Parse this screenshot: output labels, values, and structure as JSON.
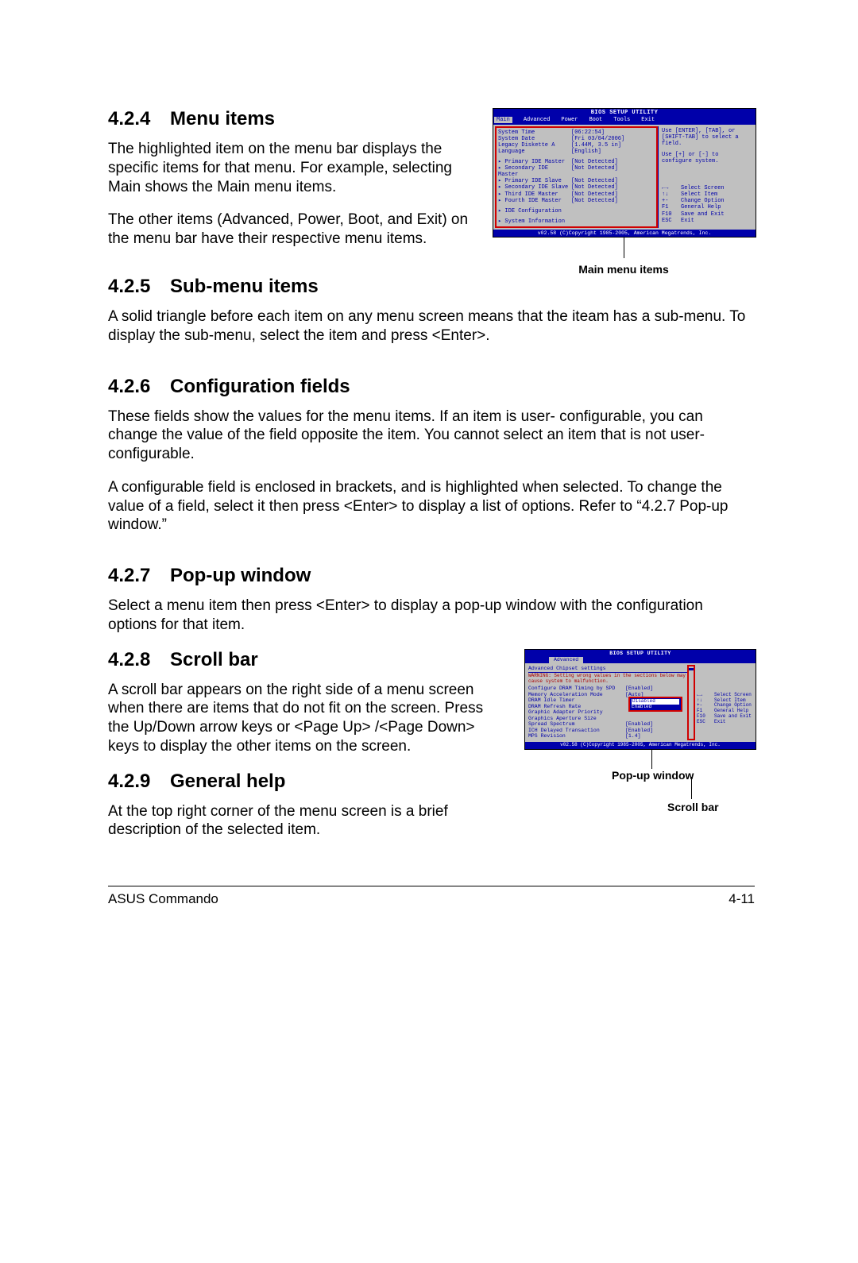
{
  "sections": {
    "s424": {
      "num": "4.2.4",
      "title": "Menu items",
      "p1": "The highlighted item on the menu bar displays the specific items for that menu. For example, selecting Main shows the Main menu items.",
      "p2": "The other items (Advanced, Power, Boot, and Exit) on the menu bar have their respective menu items."
    },
    "s425": {
      "num": "4.2.5",
      "title": "Sub-menu items",
      "p1": "A solid triangle before each item on any menu screen means that the iteam has a sub-menu. To display the sub-menu, select the item and press <Enter>."
    },
    "s426": {
      "num": "4.2.6",
      "title": "Configuration fields",
      "p1": "These fields show the values for the menu items. If an item is user- configurable, you can change the value of the field opposite the item. You cannot select an item that is not user-configurable.",
      "p2": "A configurable field is enclosed in brackets, and is highlighted when selected. To change the value of a field, select it then press <Enter> to display a list of options. Refer to “4.2.7 Pop-up window.”"
    },
    "s427": {
      "num": "4.2.7",
      "title": "Pop-up window",
      "p1": "Select a menu item then press <Enter> to display a pop-up window with the configuration options for that item."
    },
    "s428": {
      "num": "4.2.8",
      "title": "Scroll bar",
      "p1": "A scroll bar appears on the right side of a menu screen when there are items that do not fit on the screen. Press the Up/Down arrow keys or <Page Up> /<Page Down> keys to display the other items on the screen."
    },
    "s429": {
      "num": "4.2.9",
      "title": "General help",
      "p1": "At the top right corner of the menu screen is a brief description of the selected item."
    }
  },
  "captions": {
    "main_items": "Main menu items",
    "popup": "Pop-up window",
    "scroll": "Scroll bar"
  },
  "bios1": {
    "title": "BIOS SETUP UTILITY",
    "menus": [
      "Main",
      "Advanced",
      "Power",
      "Boot",
      "Tools",
      "Exit"
    ],
    "rows": [
      {
        "k": "System Time",
        "v": "[06:22:54]"
      },
      {
        "k": "System Date",
        "v": "[Fri 03/04/2006]"
      },
      {
        "k": "Legacy Diskette A",
        "v": "[1.44M, 3.5 in]"
      },
      {
        "k": "Language",
        "v": "[English]"
      }
    ],
    "ide": [
      {
        "k": "Primary IDE Master",
        "v": "[Not Detected]"
      },
      {
        "k": "Secondary IDE Master",
        "v": "[Not Detected]"
      },
      {
        "k": "Primary IDE Slave",
        "v": "[Not Detected]"
      },
      {
        "k": "Secondary IDE Slave",
        "v": "[Not Detected]"
      },
      {
        "k": "Third IDE Master",
        "v": "[Not Detected]"
      },
      {
        "k": "Fourth IDE Master",
        "v": "[Not Detected]"
      }
    ],
    "subs": [
      "IDE Configuration",
      "System Information"
    ],
    "help1": "Use [ENTER], [TAB], or [SHIFT-TAB] to select a field.",
    "help2": "Use [+] or [-] to configure system.",
    "keys": [
      {
        "k": "←→",
        "v": "Select Screen"
      },
      {
        "k": "↑↓",
        "v": "Select Item"
      },
      {
        "k": "+-",
        "v": "Change Option"
      },
      {
        "k": "F1",
        "v": "General Help"
      },
      {
        "k": "F10",
        "v": "Save and Exit"
      },
      {
        "k": "ESC",
        "v": "Exit"
      }
    ],
    "footer": "v02.58 (C)Copyright 1985-2005, American Megatrends, Inc."
  },
  "bios2": {
    "title": "BIOS SETUP UTILITY",
    "tab": "Advanced",
    "header": "Advanced Chipset settings",
    "warning": "WARNING: Setting wrong values in the sections below may cause system to malfunction.",
    "rows": [
      {
        "k": "Configure DRAM Timing by SPD",
        "v": "[Enabled]"
      },
      {
        "k": "Memory Acceleration Mode",
        "v": "[Auto]"
      },
      {
        "k": "DRAM Idle Timer",
        "v": ""
      },
      {
        "k": "DRAM Refresh Rate",
        "v": ""
      },
      {
        "k": "",
        "v": ""
      },
      {
        "k": "Graphic Adapter Priority",
        "v": ""
      },
      {
        "k": "Graphics Aperture Size",
        "v": ""
      },
      {
        "k": "Spread Spectrum",
        "v": "[Enabled]"
      },
      {
        "k": "",
        "v": ""
      },
      {
        "k": "ICH Delayed Transaction",
        "v": "[Enabled]"
      },
      {
        "k": "",
        "v": ""
      },
      {
        "k": "MPS Revision",
        "v": "[1.4]"
      }
    ],
    "popup": {
      "opt1": "Disabled",
      "opt2": "Enabled"
    },
    "keys": [
      {
        "k": "←→",
        "v": "Select Screen"
      },
      {
        "k": "↑↓",
        "v": "Select Item"
      },
      {
        "k": "+-",
        "v": "Change Option"
      },
      {
        "k": "F1",
        "v": "General Help"
      },
      {
        "k": "F10",
        "v": "Save and Exit"
      },
      {
        "k": "ESC",
        "v": "Exit"
      }
    ],
    "footer": "v02.58 (C)Copyright 1985-2005, American Megatrends, Inc."
  },
  "footer": {
    "left": "ASUS Commando",
    "right": "4-11"
  }
}
